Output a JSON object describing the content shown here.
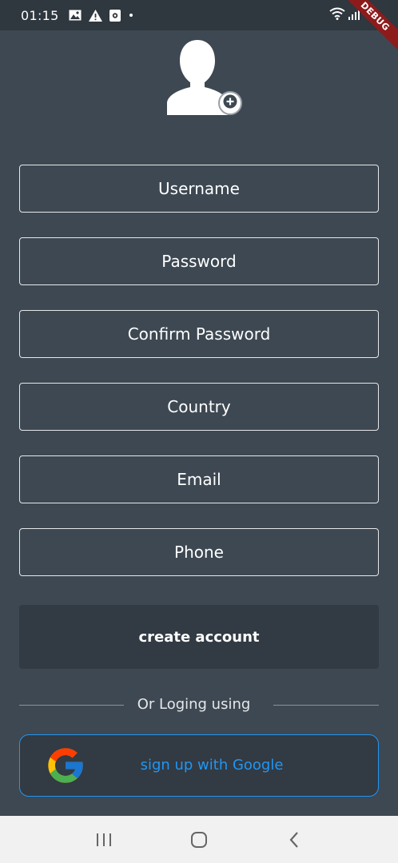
{
  "status_bar": {
    "time": "01:15",
    "icons": [
      "image-icon",
      "warning-icon",
      "app-notification-icon",
      "dot-icon",
      "wifi-icon",
      "signal-icon",
      "battery-icon"
    ],
    "debug_banner": "DEBUG"
  },
  "avatar": {
    "icon": "person-icon",
    "add_icon": "add-circle-icon"
  },
  "form": {
    "username_placeholder": "Username",
    "password_placeholder": "Password",
    "confirm_password_placeholder": "Confirm Password",
    "country_placeholder": "Country",
    "email_placeholder": "Email",
    "phone_placeholder": "Phone"
  },
  "create_button_label": "create account",
  "divider_text": "Or Loging using",
  "google_button": {
    "label": "sign up with Google",
    "icon": "google-logo-icon"
  },
  "nav_bar": {
    "icons": [
      "recent-apps-icon",
      "home-icon",
      "back-icon"
    ]
  },
  "colors": {
    "background": "#3d4852",
    "button": "#323a43",
    "accent": "#2196f3",
    "field_border": "#e6e8ea"
  }
}
